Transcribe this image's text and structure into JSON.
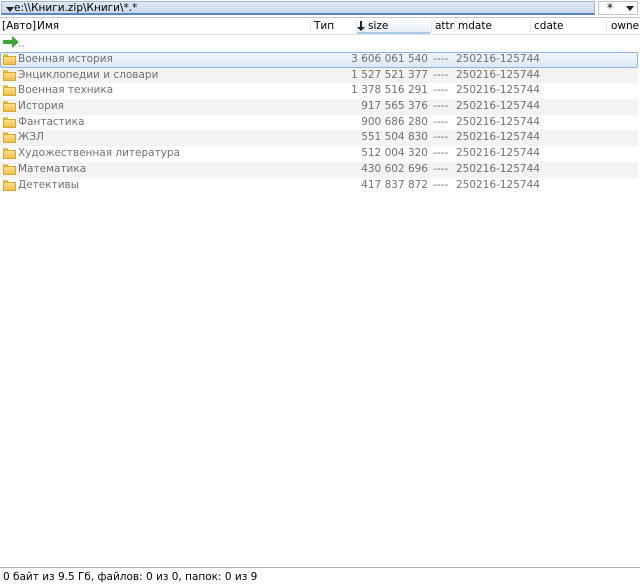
{
  "path_bar": {
    "path": "e:\\\\Книги.zip\\Книги\\*.*",
    "filter_glyph": "*",
    "dropdown_icon": "chevron-down-icon"
  },
  "columns": {
    "drive": "[Авто]",
    "name": "Имя",
    "type": "Тип",
    "size": "size",
    "attr": "attr",
    "mdate": "mdate",
    "cdate": "cdate",
    "owner": "owne"
  },
  "sort": {
    "column": "size",
    "direction": "descending"
  },
  "parent_dir": "..",
  "rows": [
    {
      "name": "Военная история",
      "size": "3 606 061 540",
      "attr": "----",
      "mdate": "250216-125744",
      "selected": true
    },
    {
      "name": "Энциклопедии и словари",
      "size": "1 527 521 377",
      "attr": "----",
      "mdate": "250216-125744"
    },
    {
      "name": "Военная техника",
      "size": "1 378 516 291",
      "attr": "----",
      "mdate": "250216-125744"
    },
    {
      "name": "История",
      "size": "917 565 376",
      "attr": "----",
      "mdate": "250216-125744"
    },
    {
      "name": "Фантастика",
      "size": "900 686 280",
      "attr": "----",
      "mdate": "250216-125744"
    },
    {
      "name": "ЖЗЛ",
      "size": "551 504 830",
      "attr": "----",
      "mdate": "250216-125744"
    },
    {
      "name": "Художественная литература",
      "size": "512 004 320",
      "attr": "----",
      "mdate": "250216-125744"
    },
    {
      "name": "Математика",
      "size": "430 602 696",
      "attr": "----",
      "mdate": "250216-125744"
    },
    {
      "name": "Детективы",
      "size": "417 837 872",
      "attr": "----",
      "mdate": "250216-125744"
    }
  ],
  "status": "0 байт из 9.5 Гб, файлов: 0 из 0, папок: 0 из 9",
  "colors": {
    "selection_border": "#8fb4e3",
    "row_alt": "#f3f3f3",
    "folder": "#f0c14b",
    "up_arrow": "#3aa832"
  }
}
